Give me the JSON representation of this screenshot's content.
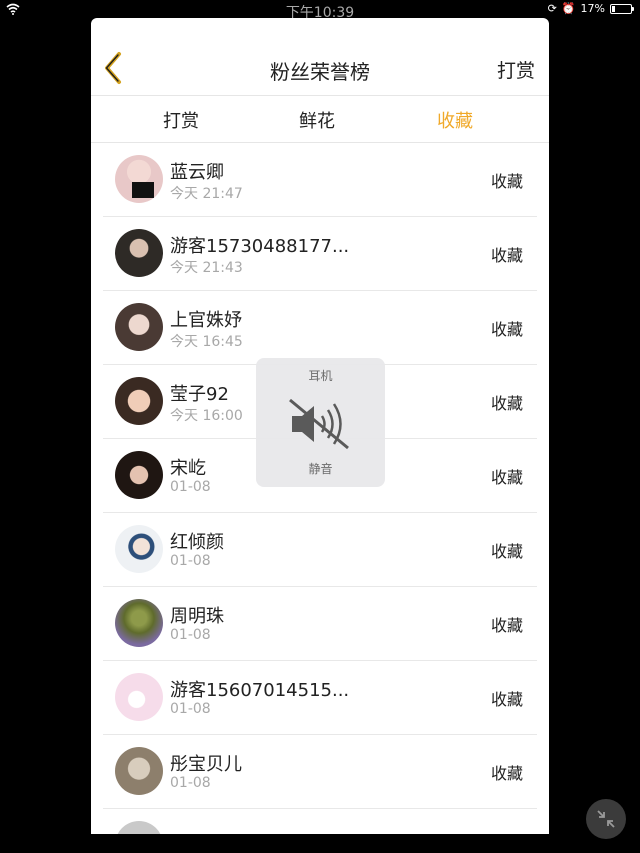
{
  "status_bar": {
    "time": "下午10:39",
    "battery": "17%",
    "battery_level": 0.17
  },
  "header": {
    "title": "粉丝荣誉榜",
    "right_action": "打赏"
  },
  "tabs": [
    {
      "label": "打赏",
      "active": false
    },
    {
      "label": "鲜花",
      "active": false
    },
    {
      "label": "收藏",
      "active": true
    }
  ],
  "accent_color": "#f0a92a",
  "rows": [
    {
      "name": "蓝云卿",
      "time": "今天 21:47",
      "action": "收藏",
      "avatar": "#e8c8c8"
    },
    {
      "name": "游客15730488177...",
      "time": "今天 21:43",
      "action": "收藏",
      "avatar": "#5a5048"
    },
    {
      "name": "上官姝妤",
      "time": "今天 16:45",
      "action": "收藏",
      "avatar": "#c7b0a4"
    },
    {
      "name": "莹子92",
      "time": "今天 16:00",
      "action": "收藏",
      "avatar": "#c89a82"
    },
    {
      "name": "宋屹",
      "time": "01-08",
      "action": "收藏",
      "avatar": "#3c2a22"
    },
    {
      "name": "红倾颜",
      "time": "01-08",
      "action": "收藏",
      "avatar": "#dfe4ea"
    },
    {
      "name": "周明珠",
      "time": "01-08",
      "action": "收藏",
      "avatar": "#6f7a3a"
    },
    {
      "name": "游客15607014515...",
      "time": "01-08",
      "action": "收藏",
      "avatar": "#f2d6e4"
    },
    {
      "name": "彤宝贝儿",
      "time": "01-08",
      "action": "收藏",
      "avatar": "#b8ab99"
    }
  ],
  "toast": {
    "top": "耳机",
    "bottom": "静音",
    "icon": "speaker-muted-icon"
  }
}
